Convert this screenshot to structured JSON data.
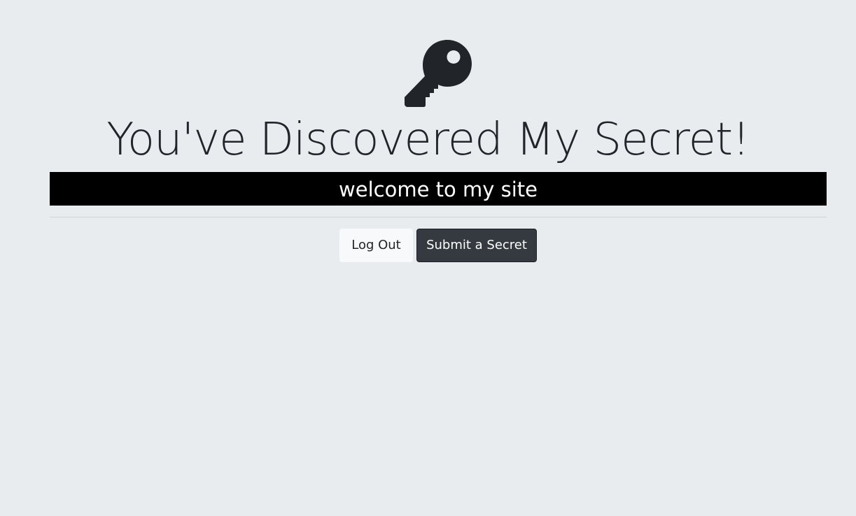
{
  "page": {
    "title": "You've Discovered My Secret!",
    "icon": "key-icon",
    "banner_text": "welcome to my site"
  },
  "buttons": {
    "logout_label": "Log Out",
    "submit_label": "Submit a Secret"
  },
  "colors": {
    "background": "#e9ecef",
    "text": "#212529",
    "banner_bg": "#000000",
    "banner_text": "#ffffff",
    "light_button": "#f8f9fa",
    "dark_button": "#343a40"
  }
}
